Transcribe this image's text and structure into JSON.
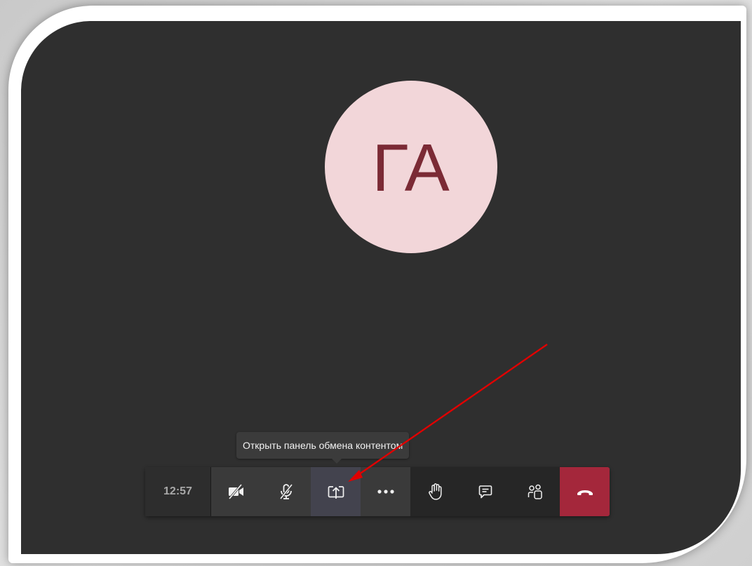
{
  "avatar": {
    "initials": "ГА",
    "bg_color": "#f2d6d9",
    "text_color": "#7b2a35"
  },
  "tooltip": {
    "text": "Открыть панель обмена контентом"
  },
  "toolbar": {
    "timer": "12:57",
    "buttons": [
      {
        "id": "camera",
        "icon": "video-off-icon"
      },
      {
        "id": "mic",
        "icon": "mic-off-icon"
      },
      {
        "id": "share",
        "icon": "share-screen-icon",
        "state": "hovered"
      },
      {
        "id": "more",
        "icon": "more-options-icon"
      },
      {
        "id": "raise-hand",
        "icon": "raise-hand-icon"
      },
      {
        "id": "chat",
        "icon": "chat-icon"
      },
      {
        "id": "participants",
        "icon": "participants-icon"
      },
      {
        "id": "hang-up",
        "icon": "hang-up-icon",
        "color": "#a4273b"
      }
    ]
  },
  "annotation": {
    "arrow_color": "#e00000"
  },
  "colors": {
    "stage_bg": "#2f2f2f",
    "toolbar_bg": "#262626",
    "hangup": "#a4273b"
  }
}
